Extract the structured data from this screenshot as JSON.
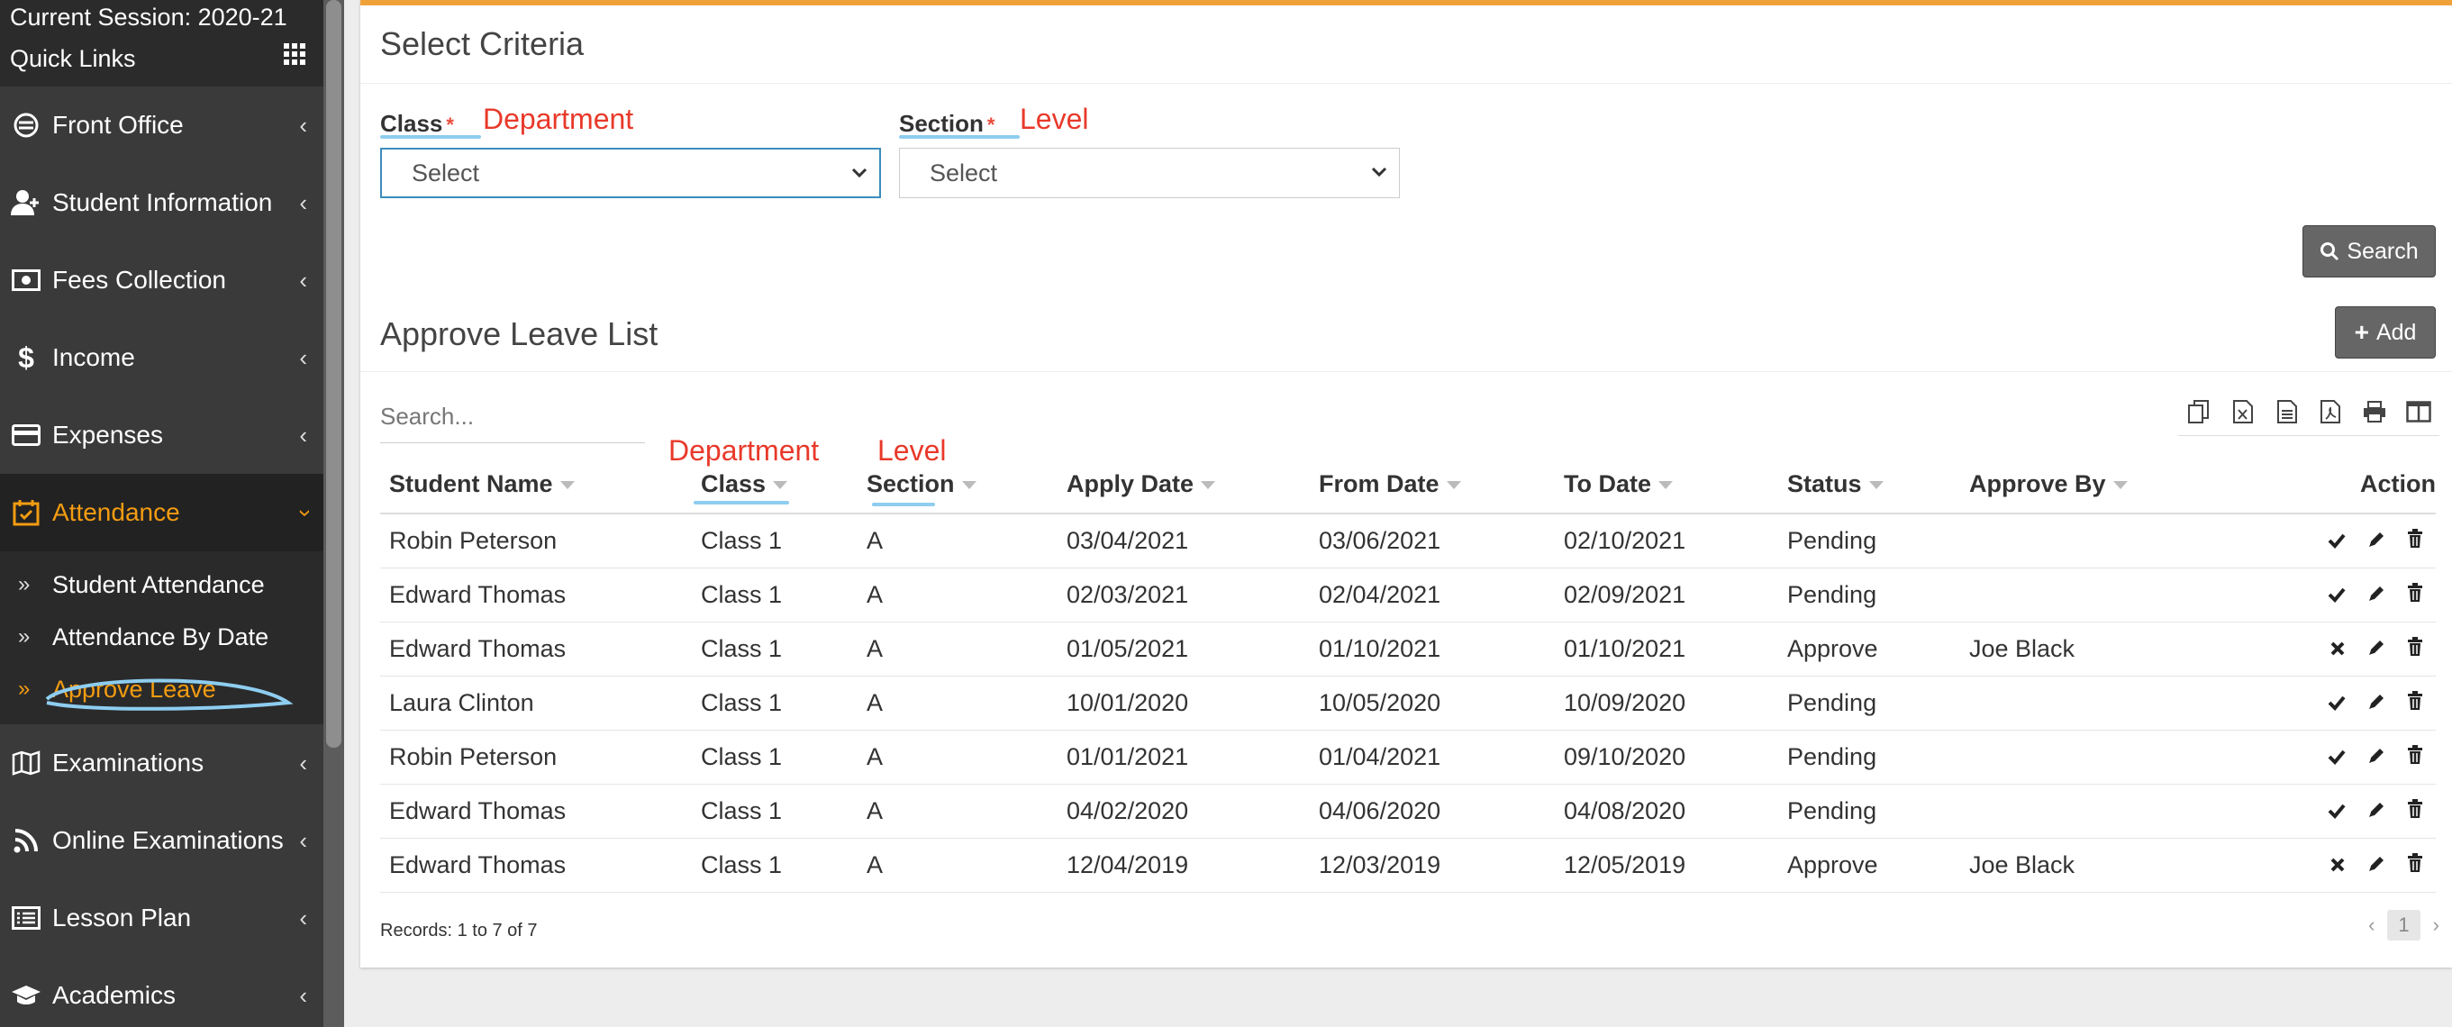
{
  "sidebar": {
    "session": "Current Session: 2020-21",
    "quick_links": "Quick Links",
    "items": [
      {
        "label": "Front Office",
        "icon": "front-office-icon"
      },
      {
        "label": "Student Information",
        "icon": "user-plus-icon"
      },
      {
        "label": "Fees Collection",
        "icon": "money-icon"
      },
      {
        "label": "Income",
        "icon": "dollar-icon"
      },
      {
        "label": "Expenses",
        "icon": "credit-card-icon"
      },
      {
        "label": "Attendance",
        "icon": "calendar-check-icon",
        "active": true
      },
      {
        "label": "Examinations",
        "icon": "map-icon"
      },
      {
        "label": "Online Examinations",
        "icon": "rss-icon"
      },
      {
        "label": "Lesson Plan",
        "icon": "list-alt-icon"
      },
      {
        "label": "Academics",
        "icon": "graduation-cap-icon"
      }
    ],
    "sub_items": [
      {
        "label": "Student Attendance"
      },
      {
        "label": "Attendance By Date"
      },
      {
        "label": "Approve Leave",
        "current": true
      }
    ]
  },
  "criteria": {
    "title": "Select Criteria",
    "class_label": "Class",
    "class_annotation": "Department",
    "section_label": "Section",
    "section_annotation": "Level",
    "required_mark": "*",
    "class_value": "Select",
    "section_value": "Select",
    "search_button": "Search"
  },
  "list": {
    "title": "Approve Leave List",
    "add_button": "Add",
    "search_placeholder": "Search...",
    "annotations": {
      "class": "Department",
      "section": "Level"
    },
    "columns": [
      "Student Name",
      "Class",
      "Section",
      "Apply Date",
      "From Date",
      "To Date",
      "Status",
      "Approve By",
      "Action"
    ],
    "rows": [
      {
        "name": "Robin Peterson",
        "class": "Class 1",
        "section": "A",
        "apply": "03/04/2021",
        "from": "03/06/2021",
        "to": "02/10/2021",
        "status": "Pending",
        "approve_by": "",
        "approved": false
      },
      {
        "name": "Edward Thomas",
        "class": "Class 1",
        "section": "A",
        "apply": "02/03/2021",
        "from": "02/04/2021",
        "to": "02/09/2021",
        "status": "Pending",
        "approve_by": "",
        "approved": false
      },
      {
        "name": "Edward Thomas",
        "class": "Class 1",
        "section": "A",
        "apply": "01/05/2021",
        "from": "01/10/2021",
        "to": "01/10/2021",
        "status": "Approve",
        "approve_by": "Joe Black",
        "approved": true
      },
      {
        "name": "Laura Clinton",
        "class": "Class 1",
        "section": "A",
        "apply": "10/01/2020",
        "from": "10/05/2020",
        "to": "10/09/2020",
        "status": "Pending",
        "approve_by": "",
        "approved": false
      },
      {
        "name": "Robin Peterson",
        "class": "Class 1",
        "section": "A",
        "apply": "01/01/2021",
        "from": "01/04/2021",
        "to": "09/10/2020",
        "status": "Pending",
        "approve_by": "",
        "approved": false
      },
      {
        "name": "Edward Thomas",
        "class": "Class 1",
        "section": "A",
        "apply": "04/02/2020",
        "from": "04/06/2020",
        "to": "04/08/2020",
        "status": "Pending",
        "approve_by": "",
        "approved": false
      },
      {
        "name": "Edward Thomas",
        "class": "Class 1",
        "section": "A",
        "apply": "12/04/2019",
        "from": "12/03/2019",
        "to": "12/05/2019",
        "status": "Approve",
        "approve_by": "Joe Black",
        "approved": true
      }
    ],
    "records": "Records: 1 to 7 of 7",
    "page": "1",
    "prev": "‹",
    "next": "›"
  },
  "colors": {
    "accent": "#f39c12",
    "annotation": "#e8392a",
    "highlight": "#8ecdf0",
    "sidebar": "#3a3a3a"
  }
}
